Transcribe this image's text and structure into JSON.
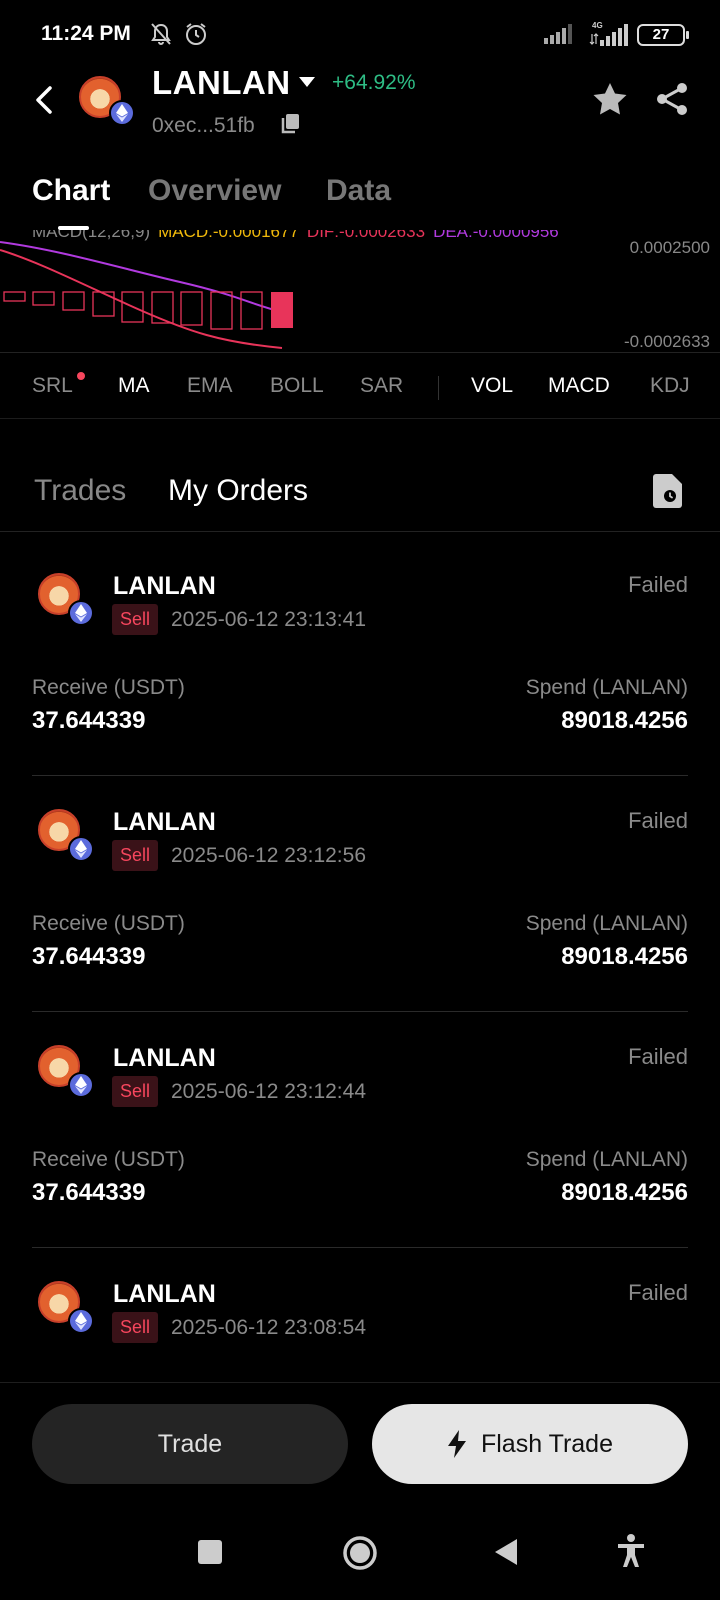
{
  "status_bar": {
    "time": "11:24 PM",
    "network": "4G",
    "battery": "27",
    "icons": [
      "bell-off-icon",
      "alarm-icon",
      "signal-icon",
      "signal-4g-icon",
      "battery-icon"
    ]
  },
  "header": {
    "token_name": "LANLAN",
    "change": "+64.92%",
    "address": "0xec...51fb",
    "change_color": "#2ebd85"
  },
  "tabs": [
    "Chart",
    "Overview",
    "Data"
  ],
  "chart": {
    "legend_label": "MACD(12,26,9)",
    "macd": "MACD:-0.0001677",
    "dif": "DIF:-0.0002633",
    "dea": "DEA:-0.0000956",
    "axis_top": "0.0002500",
    "axis_bottom": "-0.0002633",
    "colors": {
      "macd": "#f0b90b",
      "dif": "#e8345a",
      "dea": "#b13adf",
      "bar": "#e8345a"
    }
  },
  "indicators": {
    "main": [
      "SRL",
      "MA",
      "EMA",
      "BOLL",
      "SAR"
    ],
    "sub": [
      "VOL",
      "MACD",
      "KDJ"
    ]
  },
  "orders_tabs": {
    "trades": "Trades",
    "my_orders": "My Orders"
  },
  "orders": [
    {
      "token": "LANLAN",
      "status": "Failed",
      "side": "Sell",
      "time": "2025-06-12 23:13:41",
      "receive_label": "Receive (USDT)",
      "receive_value": "37.644339",
      "spend_label": "Spend (LANLAN)",
      "spend_value": "89018.4256"
    },
    {
      "token": "LANLAN",
      "status": "Failed",
      "side": "Sell",
      "time": "2025-06-12 23:12:56",
      "receive_label": "Receive (USDT)",
      "receive_value": "37.644339",
      "spend_label": "Spend (LANLAN)",
      "spend_value": "89018.4256"
    },
    {
      "token": "LANLAN",
      "status": "Failed",
      "side": "Sell",
      "time": "2025-06-12 23:12:44",
      "receive_label": "Receive (USDT)",
      "receive_value": "37.644339",
      "spend_label": "Spend (LANLAN)",
      "spend_value": "89018.4256"
    },
    {
      "token": "LANLAN",
      "status": "Failed",
      "side": "Sell",
      "time": "2025-06-12 23:08:54"
    }
  ],
  "buttons": {
    "trade": "Trade",
    "flash_trade": "Flash Trade"
  }
}
